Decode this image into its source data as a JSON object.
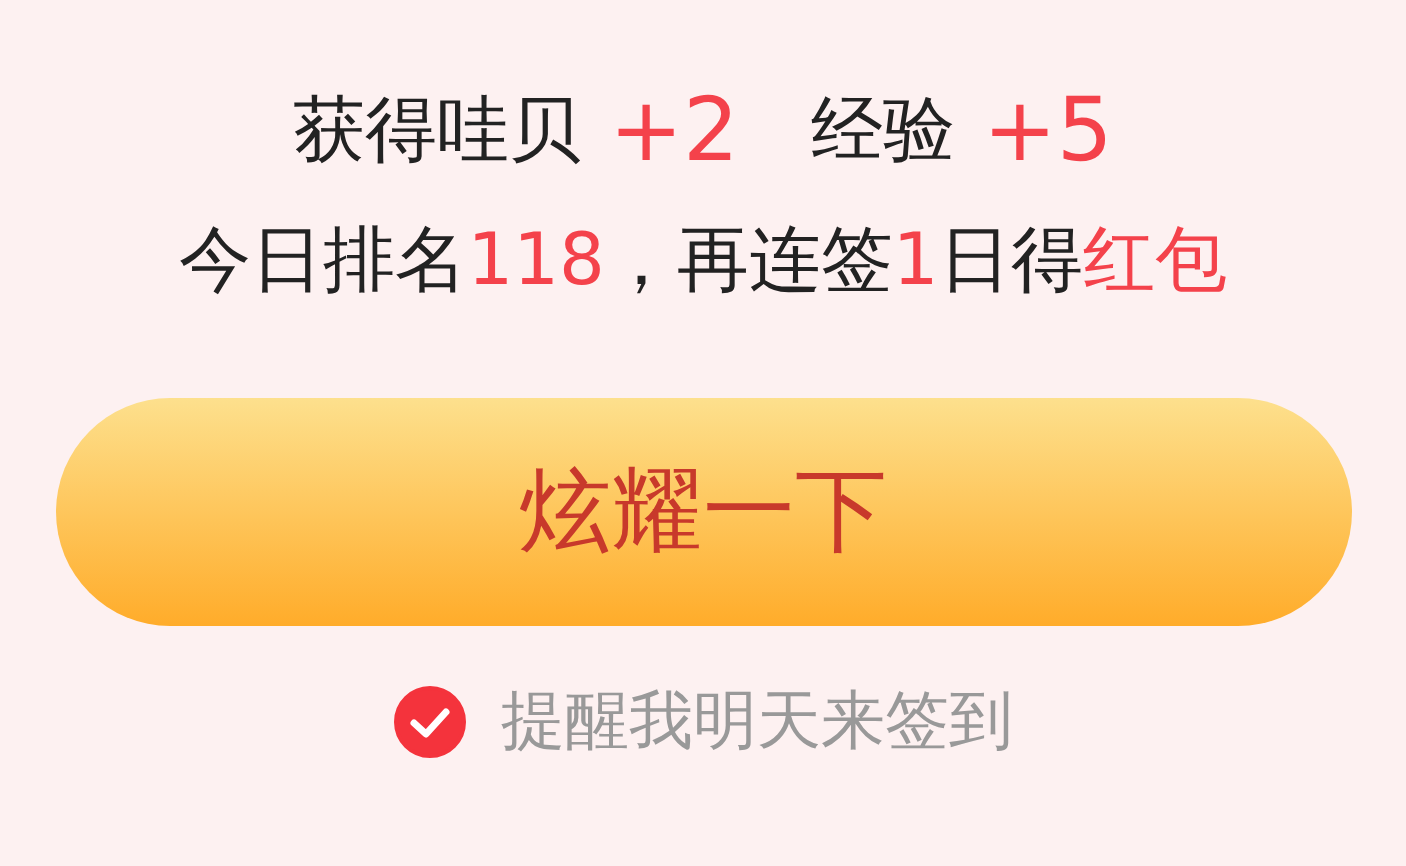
{
  "rewards": [
    {
      "label": "获得哇贝",
      "value": "+2"
    },
    {
      "label": "经验",
      "value": "+5"
    }
  ],
  "rank_line": [
    {
      "text": "今日排名",
      "highlight": false
    },
    {
      "text": "118",
      "highlight": true
    },
    {
      "text": "，再连签",
      "highlight": false
    },
    {
      "text": "1",
      "highlight": true
    },
    {
      "text": "日得",
      "highlight": false
    },
    {
      "text": "红包",
      "highlight": true
    }
  ],
  "button": {
    "label": "炫耀一下"
  },
  "reminder": {
    "label": "提醒我明天来签到",
    "checked": true
  }
}
